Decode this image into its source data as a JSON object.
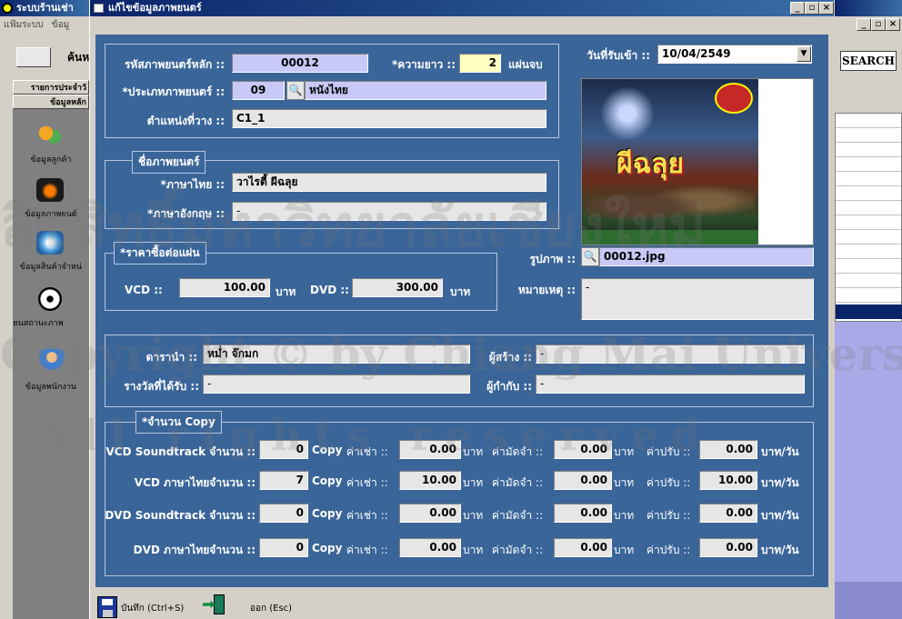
{
  "parent_window": {
    "title": "ระบบร้านเช่า",
    "menu_file": "แฟ้มระบบ",
    "menu_data": "ข้อมู",
    "search_label": "ค้นห",
    "sidebar_btn1": "รายการประจำวั",
    "sidebar_btn2": "ข้อมูลหลัก"
  },
  "sidebar": {
    "items": [
      {
        "label": "ข้อมูลลูกค้า",
        "icon": "customers-icon"
      },
      {
        "label": "ข้อมูลภาพยนต์",
        "icon": "movie-icon"
      },
      {
        "label": "ข้อมูลสินค้าจำหน่",
        "icon": "disc-product-icon"
      },
      {
        "label": "เปลี่ยนสถานะภาพ",
        "icon": "cd-status-icon"
      },
      {
        "label": "ข้อมูลพนักงาน",
        "icon": "employee-icon"
      }
    ]
  },
  "right_window": {
    "search_button": "SEARCH"
  },
  "dialog": {
    "title": "แก้ไขข้อมูลภาพยนตร์",
    "movie_code_label": "รหัสภาพยนตร์หลัก ::",
    "movie_code": "00012",
    "length_label": "*ความยาว ::",
    "length": "2",
    "length_unit": "แผ่นจบ",
    "type_label": "*ประเภทภาพยนตร์ ::",
    "type_code": "09",
    "type_name": "หนังไทย",
    "location_label": "ตำแหน่งที่วาง ::",
    "location": "C1_1",
    "date_label": "วันที่รับเข้า ::",
    "date": "10/04/2549",
    "name_section": "ชื่อภาพยนตร์",
    "thai_label": "*ภาษาไทย ::",
    "thai_name": "วาไรตี้ ผีฉลุย",
    "eng_label": "*ภาษาอังกฤษ ::",
    "eng_name": "-",
    "price_section": "*ราคาซื้อต่อแผ่น",
    "vcd_label": "VCD ::",
    "vcd_price": "100.00",
    "baht": "บาท",
    "dvd_label": "DVD ::",
    "dvd_price": "300.00",
    "image_label": "รูปภาพ ::",
    "image_file": "00012.jpg",
    "poster_text": "ผีฉลุย",
    "note_label": "หมายเหตุ ::",
    "note": "-",
    "actor_label": "ดารานำ ::",
    "actor": "หม่ำ จ๊กมก",
    "creator_label": "ผู้สร้าง ::",
    "creator": "-",
    "award_label": "รางวัลที่ได้รับ ::",
    "award": "-",
    "director_label": "ผู้กำกับ ::",
    "director": "-",
    "copy_section": "*จำนวน Copy",
    "copy_unit": "Copy",
    "rent_label": "ค่าเช่า ::",
    "deposit_label": "ค่ามัดจำ ::",
    "fine_label": "ค่าปรับ ::",
    "baht_per_day": "บาท/วัน",
    "copies": [
      {
        "label": "VCD Soundtrack จำนวน ::",
        "count": "0",
        "rent": "0.00",
        "deposit": "0.00",
        "fine": "0.00"
      },
      {
        "label": "VCD ภาษาไทยจำนวน ::",
        "count": "7",
        "rent": "10.00",
        "deposit": "0.00",
        "fine": "10.00"
      },
      {
        "label": "DVD Soundtrack จำนวน ::",
        "count": "0",
        "rent": "0.00",
        "deposit": "0.00",
        "fine": "0.00"
      },
      {
        "label": "DVD ภาษาไทยจำนวน ::",
        "count": "0",
        "rent": "0.00",
        "deposit": "0.00",
        "fine": "0.00"
      }
    ],
    "save_label": "บันทึก (Ctrl+S)",
    "exit_label": "ออก (Esc)"
  },
  "watermark": {
    "line1": "ลิขสิทธิ์มหาวิทยาลัยเชียงใหม่",
    "line2": "Copyright © by Chiang Mai University",
    "line3": "All rights reserved"
  },
  "colors": {
    "panel": "#3a6599",
    "titlebar": "#0a246a",
    "field": "#e6e6e6",
    "lavender": "#c9c9f8",
    "highlight": "#ffffc0"
  }
}
